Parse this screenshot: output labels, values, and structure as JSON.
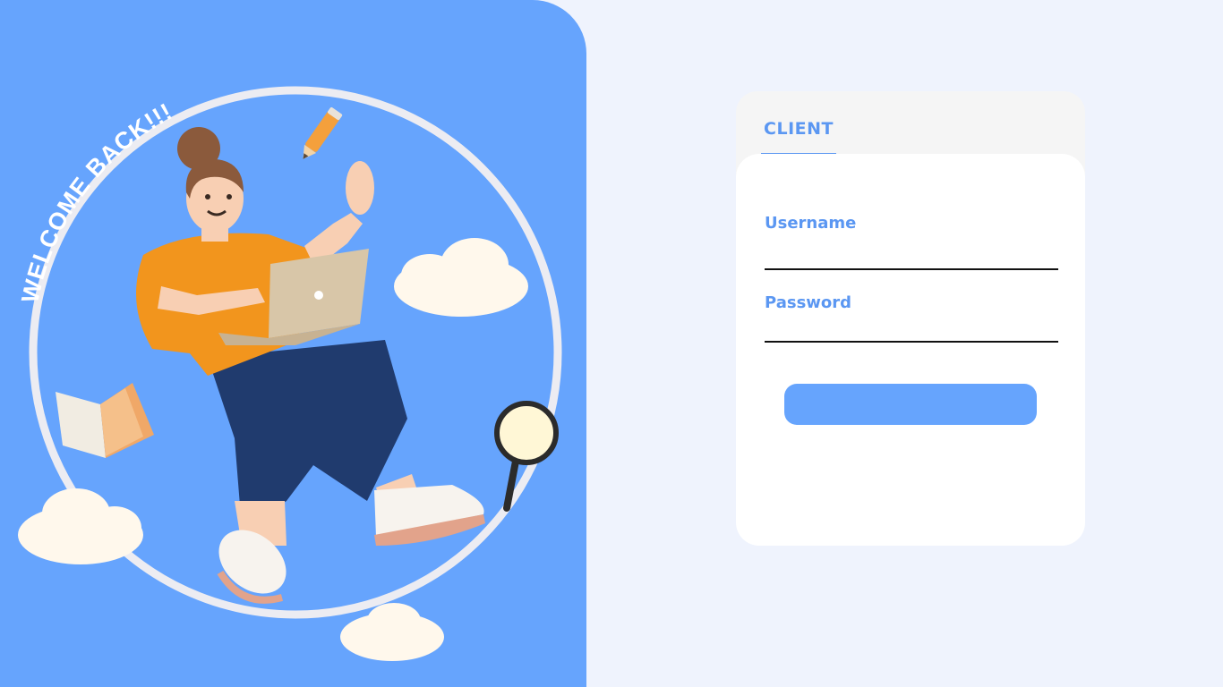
{
  "hero": {
    "welcome_text": "WELCOME BACK!!!",
    "background_color": "#66a4fd",
    "illustration": "woman-with-laptop-floating",
    "decorations": [
      "pencil-icon",
      "cloud-icon",
      "book-icon",
      "magnifying-glass-icon"
    ]
  },
  "login": {
    "tabs": [
      {
        "label": "CLIENT",
        "active": true
      }
    ],
    "username_label": "Username",
    "username_value": "",
    "password_label": "Password",
    "password_value": "",
    "submit_label": "",
    "accent_color": "#5b97f2"
  }
}
